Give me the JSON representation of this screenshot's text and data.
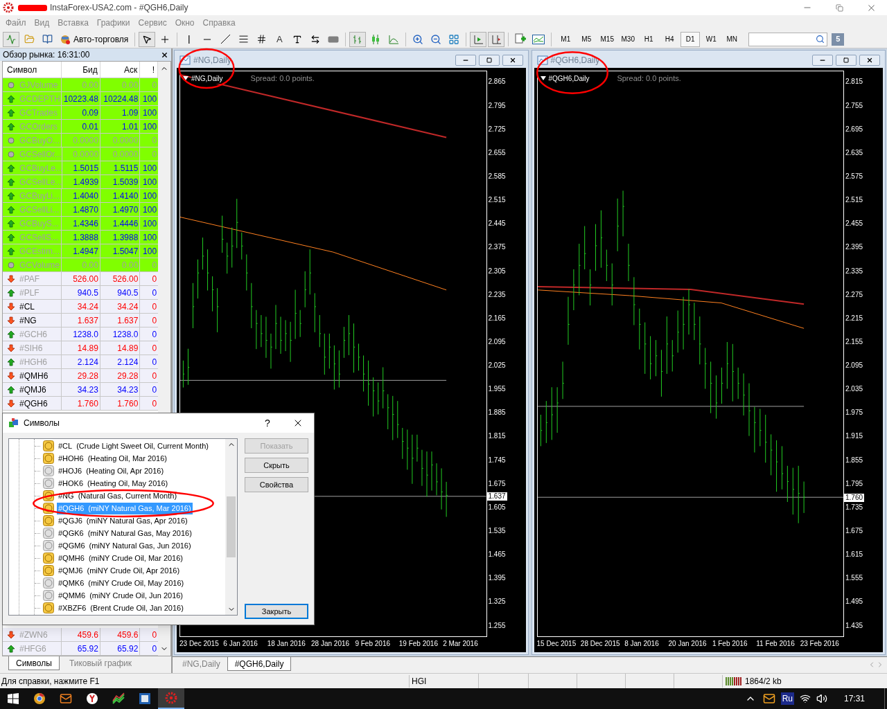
{
  "window": {
    "title": "InstaForex-USA2.com - #QGH6,Daily"
  },
  "menu": [
    "Файл",
    "Вид",
    "Вставка",
    "Графики",
    "Сервис",
    "Окно",
    "Справка"
  ],
  "toolbar": {
    "auto_trading": "Авто-торговля",
    "text_tool": "A",
    "timeframes": [
      {
        "label": "M1",
        "selected": false
      },
      {
        "label": "M5",
        "selected": false
      },
      {
        "label": "M15",
        "selected": false
      },
      {
        "label": "M30",
        "selected": false
      },
      {
        "label": "H1",
        "selected": false
      },
      {
        "label": "H4",
        "selected": false
      },
      {
        "label": "D1",
        "selected": true
      },
      {
        "label": "W1",
        "selected": false
      },
      {
        "label": "MN",
        "selected": false
      }
    ],
    "badge": "5"
  },
  "market_watch": {
    "title": "Обзор рынка: 16:31:00",
    "columns": [
      "Символ",
      "Бид",
      "Аск",
      "!"
    ],
    "rows": [
      {
        "symbol": "GJVolume",
        "bid": "0.00",
        "ask": "0.00",
        "spread": "0",
        "kind": "flat",
        "highlighted": true,
        "dimmed": true
      },
      {
        "symbol": "GCDEPTH",
        "bid": "10223.48",
        "ask": "10224.48",
        "spread": "100",
        "kind": "up",
        "highlighted": true,
        "dimmed": true
      },
      {
        "symbol": "GCTrades",
        "bid": "0.09",
        "ask": "1.09",
        "spread": "100",
        "kind": "up",
        "highlighted": true,
        "dimmed": true
      },
      {
        "symbol": "GCOrders",
        "bid": "0.01",
        "ask": "1.01",
        "spread": "100",
        "kind": "up",
        "highlighted": true,
        "dimmed": true
      },
      {
        "symbol": "GCBuyO...",
        "bid": "0.0000",
        "ask": "0.0000",
        "spread": "0",
        "kind": "flat",
        "highlighted": true,
        "dimmed": true
      },
      {
        "symbol": "GCSellOr...",
        "bid": "0.0000",
        "ask": "0.0000",
        "spread": "0",
        "kind": "flat",
        "highlighted": true,
        "dimmed": true
      },
      {
        "symbol": "GCBuyLe...",
        "bid": "1.5015",
        "ask": "1.5115",
        "spread": "100",
        "kind": "up",
        "highlighted": true,
        "dimmed": true
      },
      {
        "symbol": "GCSellLe...",
        "bid": "1.4939",
        "ask": "1.5039",
        "spread": "100",
        "kind": "up",
        "highlighted": true,
        "dimmed": true
      },
      {
        "symbol": "GCBuyLi...",
        "bid": "1.4040",
        "ask": "1.4140",
        "spread": "100",
        "kind": "up",
        "highlighted": true,
        "dimmed": true
      },
      {
        "symbol": "GCSellLi...",
        "bid": "1.4870",
        "ask": "1.4970",
        "spread": "100",
        "kind": "up",
        "highlighted": true,
        "dimmed": true
      },
      {
        "symbol": "GCBuyS...",
        "bid": "1.4346",
        "ask": "1.4446",
        "spread": "100",
        "kind": "up",
        "highlighted": true,
        "dimmed": true
      },
      {
        "symbol": "GCSellS...",
        "bid": "1.3888",
        "ask": "1.3988",
        "spread": "100",
        "kind": "up",
        "highlighted": true,
        "dimmed": true
      },
      {
        "symbol": "GCEstim...",
        "bid": "1.4947",
        "ask": "1.5047",
        "spread": "100",
        "kind": "up",
        "highlighted": true,
        "dimmed": true
      },
      {
        "symbol": "GCVolume",
        "bid": "0.00",
        "ask": "0.00",
        "spread": "0",
        "kind": "flat",
        "highlighted": true,
        "dimmed": true
      },
      {
        "symbol": "#PAF",
        "bid": "526.00",
        "ask": "526.00",
        "spread": "0",
        "kind": "down",
        "highlighted": false,
        "dimmed": true
      },
      {
        "symbol": "#PLF",
        "bid": "940.5",
        "ask": "940.5",
        "spread": "0",
        "kind": "up",
        "highlighted": false,
        "dimmed": true
      },
      {
        "symbol": "#CL",
        "bid": "34.24",
        "ask": "34.24",
        "spread": "0",
        "kind": "down",
        "highlighted": false,
        "dimmed": false
      },
      {
        "symbol": "#NG",
        "bid": "1.637",
        "ask": "1.637",
        "spread": "0",
        "kind": "down",
        "highlighted": false,
        "dimmed": false
      },
      {
        "symbol": "#GCH6",
        "bid": "1238.0",
        "ask": "1238.0",
        "spread": "0",
        "kind": "up",
        "highlighted": false,
        "dimmed": true
      },
      {
        "symbol": "#SIH6",
        "bid": "14.89",
        "ask": "14.89",
        "spread": "0",
        "kind": "down",
        "highlighted": false,
        "dimmed": true
      },
      {
        "symbol": "#HGH6",
        "bid": "2.124",
        "ask": "2.124",
        "spread": "0",
        "kind": "up",
        "highlighted": false,
        "dimmed": true
      },
      {
        "symbol": "#QMH6",
        "bid": "29.28",
        "ask": "29.28",
        "spread": "0",
        "kind": "down",
        "highlighted": false,
        "dimmed": false
      },
      {
        "symbol": "#QMJ6",
        "bid": "34.23",
        "ask": "34.23",
        "spread": "0",
        "kind": "up",
        "highlighted": false,
        "dimmed": false
      },
      {
        "symbol": "#QGH6",
        "bid": "1.760",
        "ask": "1.760",
        "spread": "0",
        "kind": "down",
        "highlighted": false,
        "dimmed": false
      }
    ],
    "rows_below": [
      {
        "symbol": "#ZWN6",
        "bid": "459.6",
        "ask": "459.6",
        "spread": "0",
        "kind": "down",
        "highlighted": false,
        "dimmed": true
      },
      {
        "symbol": "#HFG6",
        "bid": "65.92",
        "ask": "65.92",
        "spread": "0",
        "kind": "up",
        "highlighted": false,
        "dimmed": true
      }
    ],
    "tabs": [
      {
        "label": "Символы",
        "selected": true
      },
      {
        "label": "Тиковый график",
        "selected": false
      }
    ]
  },
  "charts": [
    {
      "title": "#NG,Daily",
      "label": "#NG,Daily",
      "spread": "Spread: 0.0 points.",
      "price": "1.637",
      "price_axis": [
        "2.865",
        "2.795",
        "2.725",
        "2.655",
        "2.585",
        "2.515",
        "2.445",
        "2.375",
        "2.305",
        "2.235",
        "2.165",
        "2.095",
        "2.025",
        "1.955",
        "1.885",
        "1.815",
        "1.745",
        "1.675",
        "1.605",
        "1.535",
        "1.465",
        "1.395",
        "1.325",
        "1.255"
      ],
      "date_axis": [
        "23 Dec 2015",
        "6 Jan 2016",
        "18 Jan 2016",
        "28 Jan 2016",
        "9 Feb 2016",
        "19 Feb 2016",
        "2 Mar 2016"
      ]
    },
    {
      "title": "#QGH6,Daily",
      "label": "#QGH6,Daily",
      "spread": "Spread: 0.0 points.",
      "price": "1.760",
      "price_axis": [
        "2.815",
        "2.755",
        "2.695",
        "2.635",
        "2.575",
        "2.515",
        "2.455",
        "2.395",
        "2.335",
        "2.275",
        "2.215",
        "2.155",
        "2.095",
        "2.035",
        "1.975",
        "1.915",
        "1.855",
        "1.795",
        "1.735",
        "1.675",
        "1.615",
        "1.555",
        "1.495",
        "1.435"
      ],
      "date_axis": [
        "15 Dec 2015",
        "28 Dec 2015",
        "8 Jan 2016",
        "20 Jan 2016",
        "1 Feb 2016",
        "11 Feb 2016",
        "23 Feb 2016"
      ]
    }
  ],
  "chart_tabs": [
    {
      "label": "#NG,Daily",
      "selected": false
    },
    {
      "label": "#QGH6,Daily",
      "selected": true
    }
  ],
  "dialog": {
    "title": "Символы",
    "help": "?",
    "items": [
      {
        "symbol": "#CL",
        "description": "(Crude Light Sweet Oil, Current Month)",
        "active": true,
        "selected": false
      },
      {
        "symbol": "#HOH6",
        "description": "(Heating Oil, Mar 2016)",
        "active": true,
        "selected": false
      },
      {
        "symbol": "#HOJ6",
        "description": "(Heating Oil, Apr 2016)",
        "active": false,
        "selected": false
      },
      {
        "symbol": "#HOK6",
        "description": "(Heating Oil, May 2016)",
        "active": false,
        "selected": false
      },
      {
        "symbol": "#NG",
        "description": "(Natural Gas, Current Month)",
        "active": true,
        "selected": false
      },
      {
        "symbol": "#QGH6",
        "description": "(miNY Natural Gas, Mar 2016)",
        "active": true,
        "selected": true
      },
      {
        "symbol": "#QGJ6",
        "description": "(miNY Natural Gas, Apr 2016)",
        "active": true,
        "selected": false
      },
      {
        "symbol": "#QGK6",
        "description": "(miNY Natural Gas, May 2016)",
        "active": false,
        "selected": false
      },
      {
        "symbol": "#QGM6",
        "description": "(miNY Natural Gas, Jun 2016)",
        "active": false,
        "selected": false
      },
      {
        "symbol": "#QMH6",
        "description": "(miNY Crude Oil, Mar 2016)",
        "active": true,
        "selected": false
      },
      {
        "symbol": "#QMJ6",
        "description": "(miNY Crude Oil, Apr 2016)",
        "active": true,
        "selected": false
      },
      {
        "symbol": "#QMK6",
        "description": "(miNY Crude Oil, May 2016)",
        "active": false,
        "selected": false
      },
      {
        "symbol": "#QMM6",
        "description": "(miNY Crude Oil, Jun 2016)",
        "active": false,
        "selected": false
      },
      {
        "symbol": "#XBZF6",
        "description": "(Brent Crude Oil, Jan 2016)",
        "active": true,
        "selected": false
      }
    ],
    "buttons": [
      {
        "label": "Показать",
        "disabled": true,
        "default": false
      },
      {
        "label": "Скрыть",
        "disabled": false,
        "default": false
      },
      {
        "label": "Свойства",
        "disabled": false,
        "default": false
      }
    ],
    "close_button": {
      "label": "Закрыть",
      "disabled": false,
      "default": true
    }
  },
  "status_bar": {
    "help": "Для справки, нажмите F1",
    "profile": "HGI",
    "traffic": "1864/2 kb"
  },
  "taskbar": {
    "language": "Ru",
    "time": "17:31"
  }
}
